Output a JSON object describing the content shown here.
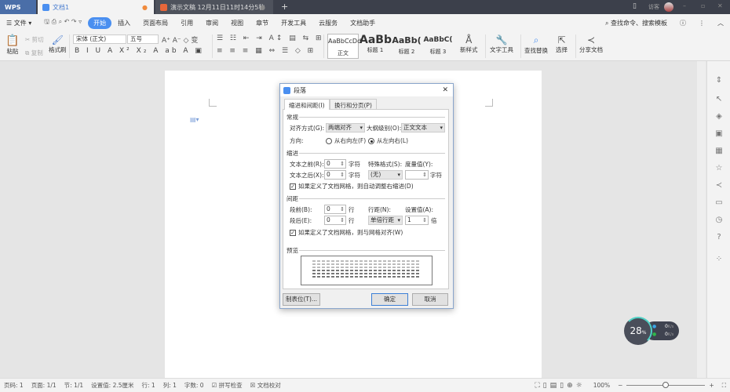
{
  "titlebar": {
    "wps": "WPS",
    "tabs": [
      {
        "label": "文档1"
      },
      {
        "label": "演示文稿 12月11日11时14分5秒"
      }
    ],
    "user": "访客"
  },
  "menu": {
    "file": "文件",
    "items": [
      "开始",
      "插入",
      "页面布局",
      "引用",
      "审阅",
      "视图",
      "章节",
      "开发工具",
      "云服务",
      "文档助手"
    ],
    "search": "查找命令、搜索模板"
  },
  "ribbon": {
    "paste": "粘贴",
    "cut": "剪切",
    "copy": "复制",
    "format_painter": "格式刷",
    "font": "宋体 (正文)",
    "size": "五号",
    "styles": [
      {
        "preview": "AaBbCcDd",
        "label": "正文"
      },
      {
        "preview": "AaBb",
        "label": "标题 1"
      },
      {
        "preview": "AaBb(",
        "label": "标题 2"
      },
      {
        "preview": "AaBbC(",
        "label": "标题 3"
      }
    ],
    "new_style": "新样式",
    "text_tools": "文字工具",
    "find_replace": "查找替换",
    "select": "选择",
    "share": "分享文档"
  },
  "dialog": {
    "title": "段落",
    "tabs": [
      "缩进和间距(I)",
      "换行和分页(P)"
    ],
    "general": "常规",
    "align_label": "对齐方式(G):",
    "align_value": "两端对齐",
    "outline_label": "大纲级别(O):",
    "outline_value": "正文文本",
    "direction_label": "方向:",
    "rtl": "从右向左(F)",
    "ltr": "从左向右(L)",
    "indent": "缩进",
    "before_text": "文本之前(R):",
    "before_text_value": "0",
    "after_text": "文本之后(X):",
    "after_text_value": "0",
    "unit_char": "字符",
    "special_label": "特殊格式(S):",
    "special_value": "(无)",
    "measure_label": "度量值(Y):",
    "measure_value": "",
    "indent_check": "如果定义了文档网格，则自动调整右缩进(D)",
    "spacing": "间距",
    "before": "段前(B):",
    "before_value": "0",
    "after": "段后(E):",
    "after_value": "0",
    "unit_line": "行",
    "line_spacing_label": "行距(N):",
    "line_spacing_value": "单倍行距",
    "set_value_label": "设置值(A):",
    "set_value": "1",
    "unit_times": "倍",
    "grid_check": "如果定义了文档网格，则与网格对齐(W)",
    "preview": "预览",
    "tabs_button": "制表位(T)...",
    "ok": "确定",
    "cancel": "取消"
  },
  "speed": {
    "percent": "28",
    "unit": "%",
    "up": "0",
    "down": "0",
    "rate_unit": "K/s"
  },
  "status": {
    "page_num": "页码: 1",
    "pages": "页面: 1/1",
    "section": "节: 1/1",
    "setting": "设置值: 2.5厘米",
    "row": "行: 1",
    "col": "列: 1",
    "words": "字数: 0",
    "spell": "拼写检查",
    "proof": "文档校对",
    "zoom": "100%",
    "zoom_fraction": 0.5
  },
  "colors": {
    "accent": "#4a8ff0",
    "titlebar": "#3c404b"
  }
}
